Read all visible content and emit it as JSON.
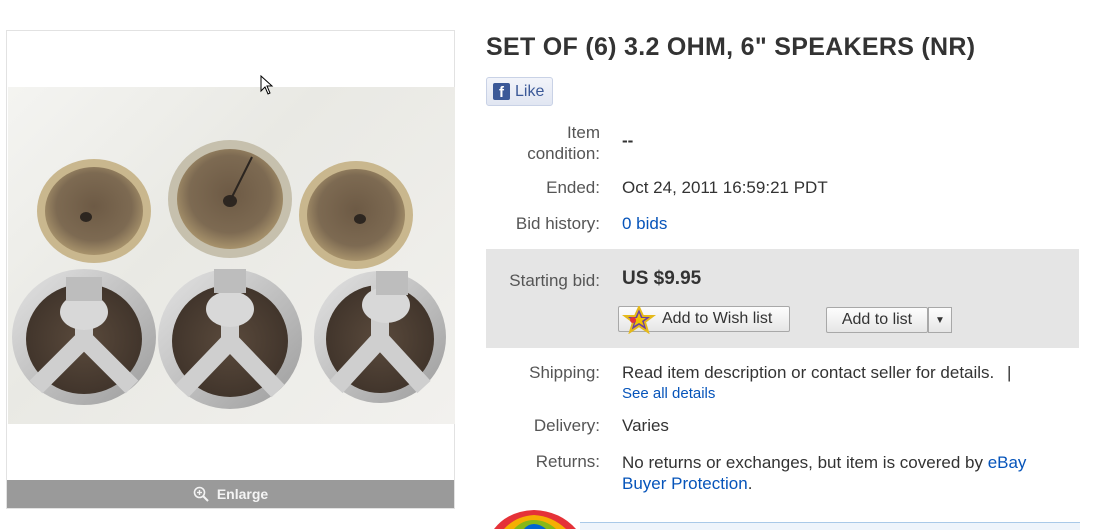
{
  "listing": {
    "title": "SET OF (6) 3.2 OHM, 6\" SPEAKERS (NR)",
    "image_alt": "Six vintage speakers",
    "enlarge_label": "Enlarge"
  },
  "social": {
    "like_label": "Like",
    "fb_letter": "f"
  },
  "details": {
    "condition_label_line1": "Item",
    "condition_label_line2": "condition:",
    "condition_value": "--",
    "ended_label": "Ended:",
    "ended_value": "Oct 24, 2011  16:59:21 PDT",
    "bid_history_label": "Bid history:",
    "bid_history_value": "0 bids"
  },
  "bidding": {
    "starting_bid_label": "Starting bid:",
    "starting_bid_value": "US $9.95",
    "wish_list_button": "Add to Wish list",
    "add_to_list_button": "Add to list"
  },
  "shipping": {
    "shipping_label": "Shipping:",
    "shipping_value": "Read item description or contact seller for details.",
    "separator": "|",
    "see_all_details": "See all details",
    "delivery_label": "Delivery:",
    "delivery_value": "Varies",
    "returns_label": "Returns:",
    "returns_value": "No returns or exchanges, but item is covered by",
    "returns_link_line1": "eBay",
    "returns_link_line2": "Buyer Protection",
    "returns_period": "."
  },
  "colors": {
    "link": "#0654ba",
    "bid_box": "#e5e5e5",
    "enlarge_bar": "#9a9a9a",
    "facebook": "#3b5998"
  }
}
